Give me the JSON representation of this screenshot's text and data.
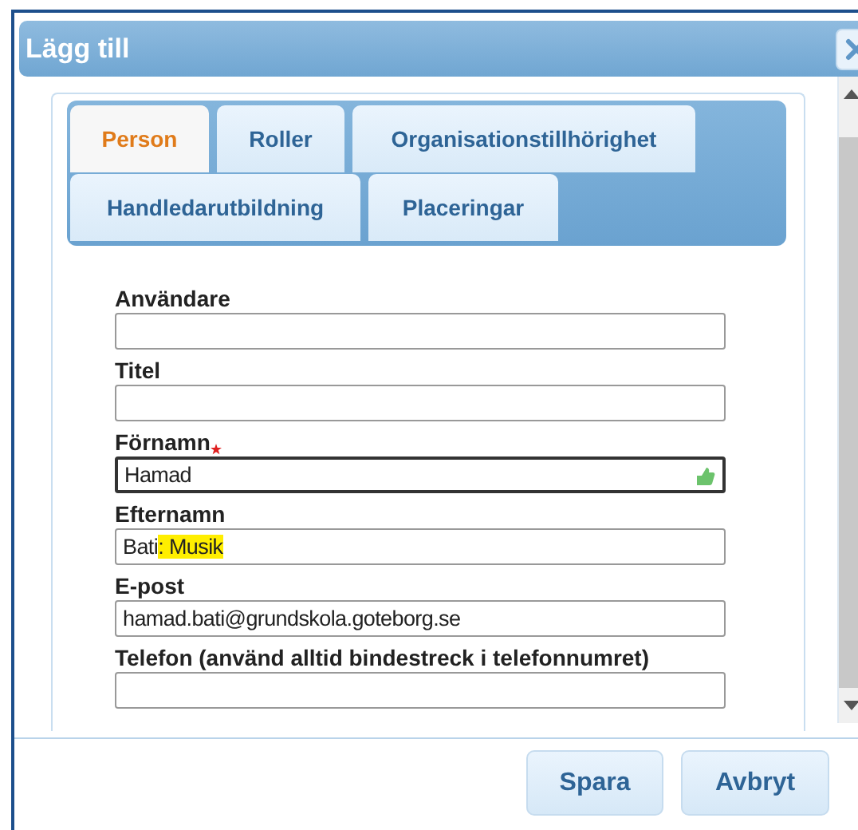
{
  "window": {
    "title": "Lägg till"
  },
  "tabs": [
    {
      "label": "Person",
      "selected": true
    },
    {
      "label": "Roller",
      "selected": false
    },
    {
      "label": "Organisationstillhörighet",
      "selected": false
    },
    {
      "label": "Handledarutbildning",
      "selected": false
    },
    {
      "label": "Placeringar",
      "selected": false
    }
  ],
  "fields": [
    {
      "label": "Användare",
      "required": false,
      "focused": false
    },
    {
      "label": "Titel",
      "required": false,
      "focused": false
    },
    {
      "label": "Förnamn",
      "required": true,
      "focused": true,
      "value": "Hamad"
    },
    {
      "label": "Efternamn",
      "required": false,
      "focused": false,
      "value": "Bati",
      "highlighted_value": ": Musik"
    },
    {
      "label": "E-post",
      "required": false,
      "focused": false,
      "value": "hamad.bati@grundskola.goteborg.se"
    },
    {
      "label": "Telefon (använd alltid bindestreck i telefonnumret)",
      "required": false,
      "focused": false
    }
  ],
  "buttons": [
    "Spara",
    "Avbryt"
  ]
}
